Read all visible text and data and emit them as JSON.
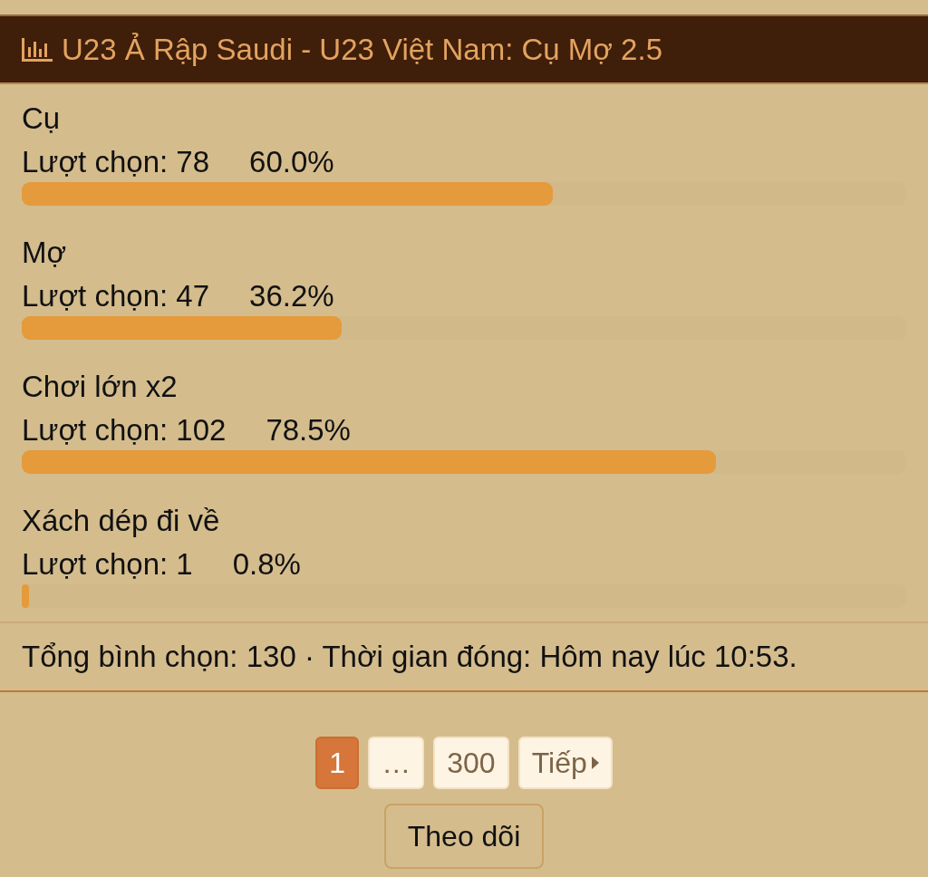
{
  "poll": {
    "title": "U23 Ả Rập Saudi - U23 Việt Nam: Cụ Mợ 2.5",
    "options": [
      {
        "label": "Cụ",
        "votes": "Lượt chọn: 78",
        "percent": "60.0%",
        "level": 0.6
      },
      {
        "label": "Mợ",
        "votes": "Lượt chọn: 47",
        "percent": "36.2%",
        "level": 0.362
      },
      {
        "label": "Chơi lớn x2",
        "votes": "Lượt chọn: 102",
        "percent": "78.5%",
        "level": 0.785
      },
      {
        "label": "Xách dép đi về",
        "votes": "Lượt chọn: 1",
        "percent": "0.8%",
        "level": 0.008
      }
    ],
    "summary": "Tổng bình chọn: 130 · Thời gian đóng: Hôm nay lúc 10:53."
  },
  "pagination": {
    "pages": [
      {
        "label": "1",
        "selected": true
      },
      {
        "label": "…",
        "selected": false
      },
      {
        "label": "300",
        "selected": false
      }
    ],
    "next": "Tiếp"
  },
  "follow_button": "Theo dõi"
}
